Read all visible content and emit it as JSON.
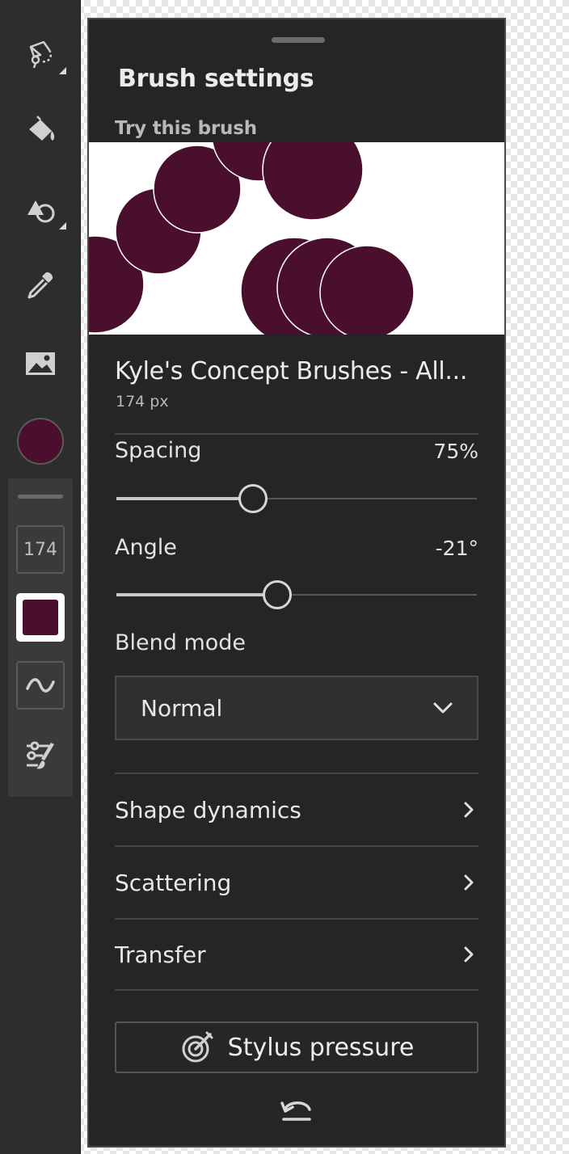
{
  "colors": {
    "brush": "#4a0f2c",
    "panel": "#252525",
    "toolbar": "#2d2d2d"
  },
  "toolbar": {
    "tools": [
      {
        "icon": "lasso-select-icon",
        "has_submenu": true
      },
      {
        "icon": "paint-bucket-icon",
        "has_submenu": false
      },
      {
        "icon": "shape-tool-icon",
        "has_submenu": true
      },
      {
        "icon": "eyedropper-icon",
        "has_submenu": false
      },
      {
        "icon": "image-icon",
        "has_submenu": false
      }
    ],
    "brush_size": "174",
    "smoothing_icon": "smoothing-wave-icon",
    "settings_icon": "brush-settings-icon"
  },
  "panel": {
    "title": "Brush settings",
    "try_label": "Try this brush",
    "brush_name": "Kyle's Concept Brushes - All...",
    "brush_size": "174 px",
    "spacing": {
      "label": "Spacing",
      "value": "75%",
      "fraction": 0.38
    },
    "angle": {
      "label": "Angle",
      "value": "-21°",
      "fraction": 0.446
    },
    "blend_mode": {
      "label": "Blend mode",
      "value": "Normal"
    },
    "sections": [
      {
        "label": "Shape dynamics"
      },
      {
        "label": "Scattering"
      },
      {
        "label": "Transfer"
      }
    ],
    "stylus_pressure": "Stylus pressure",
    "reset_icon": "reset-icon"
  }
}
